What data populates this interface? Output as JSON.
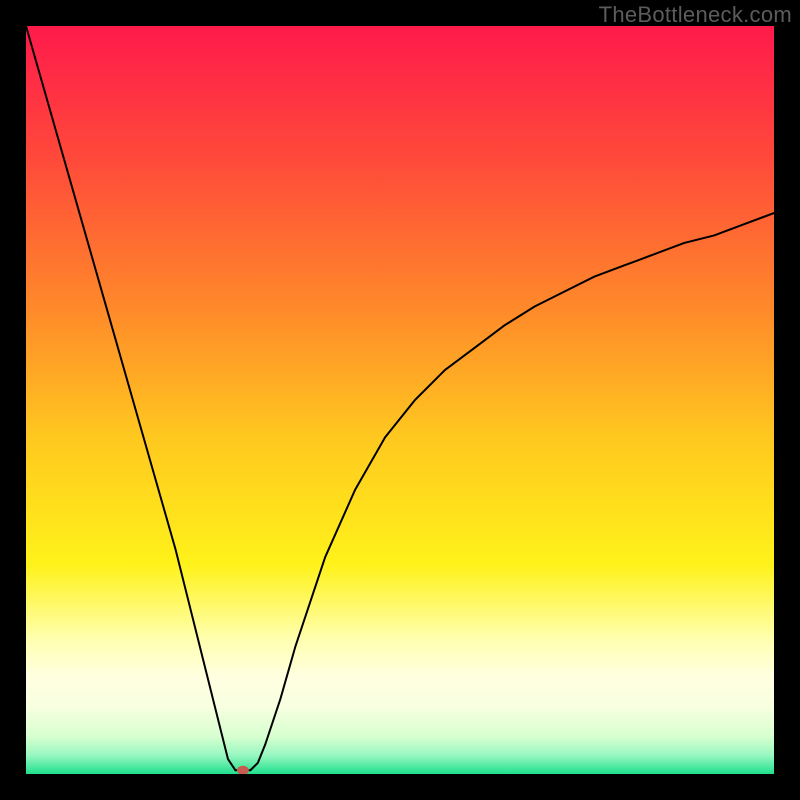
{
  "watermark": "TheBottleneck.com",
  "chart_data": {
    "type": "line",
    "title": "",
    "xlabel": "",
    "ylabel": "",
    "xlim": [
      0,
      100
    ],
    "ylim": [
      0,
      100
    ],
    "grid": false,
    "legend": false,
    "background_gradient_stops": [
      {
        "offset": 0.0,
        "color": "#ff1a4b"
      },
      {
        "offset": 0.18,
        "color": "#ff4a3a"
      },
      {
        "offset": 0.38,
        "color": "#ff8a2a"
      },
      {
        "offset": 0.55,
        "color": "#ffc81f"
      },
      {
        "offset": 0.72,
        "color": "#fff21a"
      },
      {
        "offset": 0.82,
        "color": "#ffffb0"
      },
      {
        "offset": 0.87,
        "color": "#ffffe0"
      },
      {
        "offset": 0.91,
        "color": "#f7ffe0"
      },
      {
        "offset": 0.95,
        "color": "#d7ffd0"
      },
      {
        "offset": 0.975,
        "color": "#98f7c0"
      },
      {
        "offset": 1.0,
        "color": "#1ee08c"
      }
    ],
    "series": [
      {
        "name": "bottleneck-curve",
        "color": "#000000",
        "stroke_width": 2,
        "x": [
          0,
          2,
          4,
          6,
          8,
          10,
          12,
          14,
          16,
          18,
          20,
          22,
          24,
          26,
          27,
          28,
          29,
          30,
          31,
          32,
          34,
          36,
          38,
          40,
          44,
          48,
          52,
          56,
          60,
          64,
          68,
          72,
          76,
          80,
          84,
          88,
          92,
          96,
          100
        ],
        "y": [
          100,
          93,
          86,
          79,
          72,
          65,
          58,
          51,
          44,
          37,
          30,
          22,
          14,
          6,
          2,
          0.5,
          0.5,
          0.5,
          1.5,
          4,
          10,
          17,
          23,
          29,
          38,
          45,
          50,
          54,
          57,
          60,
          62.5,
          64.5,
          66.5,
          68,
          69.5,
          71,
          72,
          73.5,
          75
        ]
      }
    ],
    "marker": {
      "name": "optimum-point",
      "x": 29,
      "y": 0.5,
      "rx": 6,
      "ry": 4.5,
      "color": "#c75b4f"
    }
  }
}
